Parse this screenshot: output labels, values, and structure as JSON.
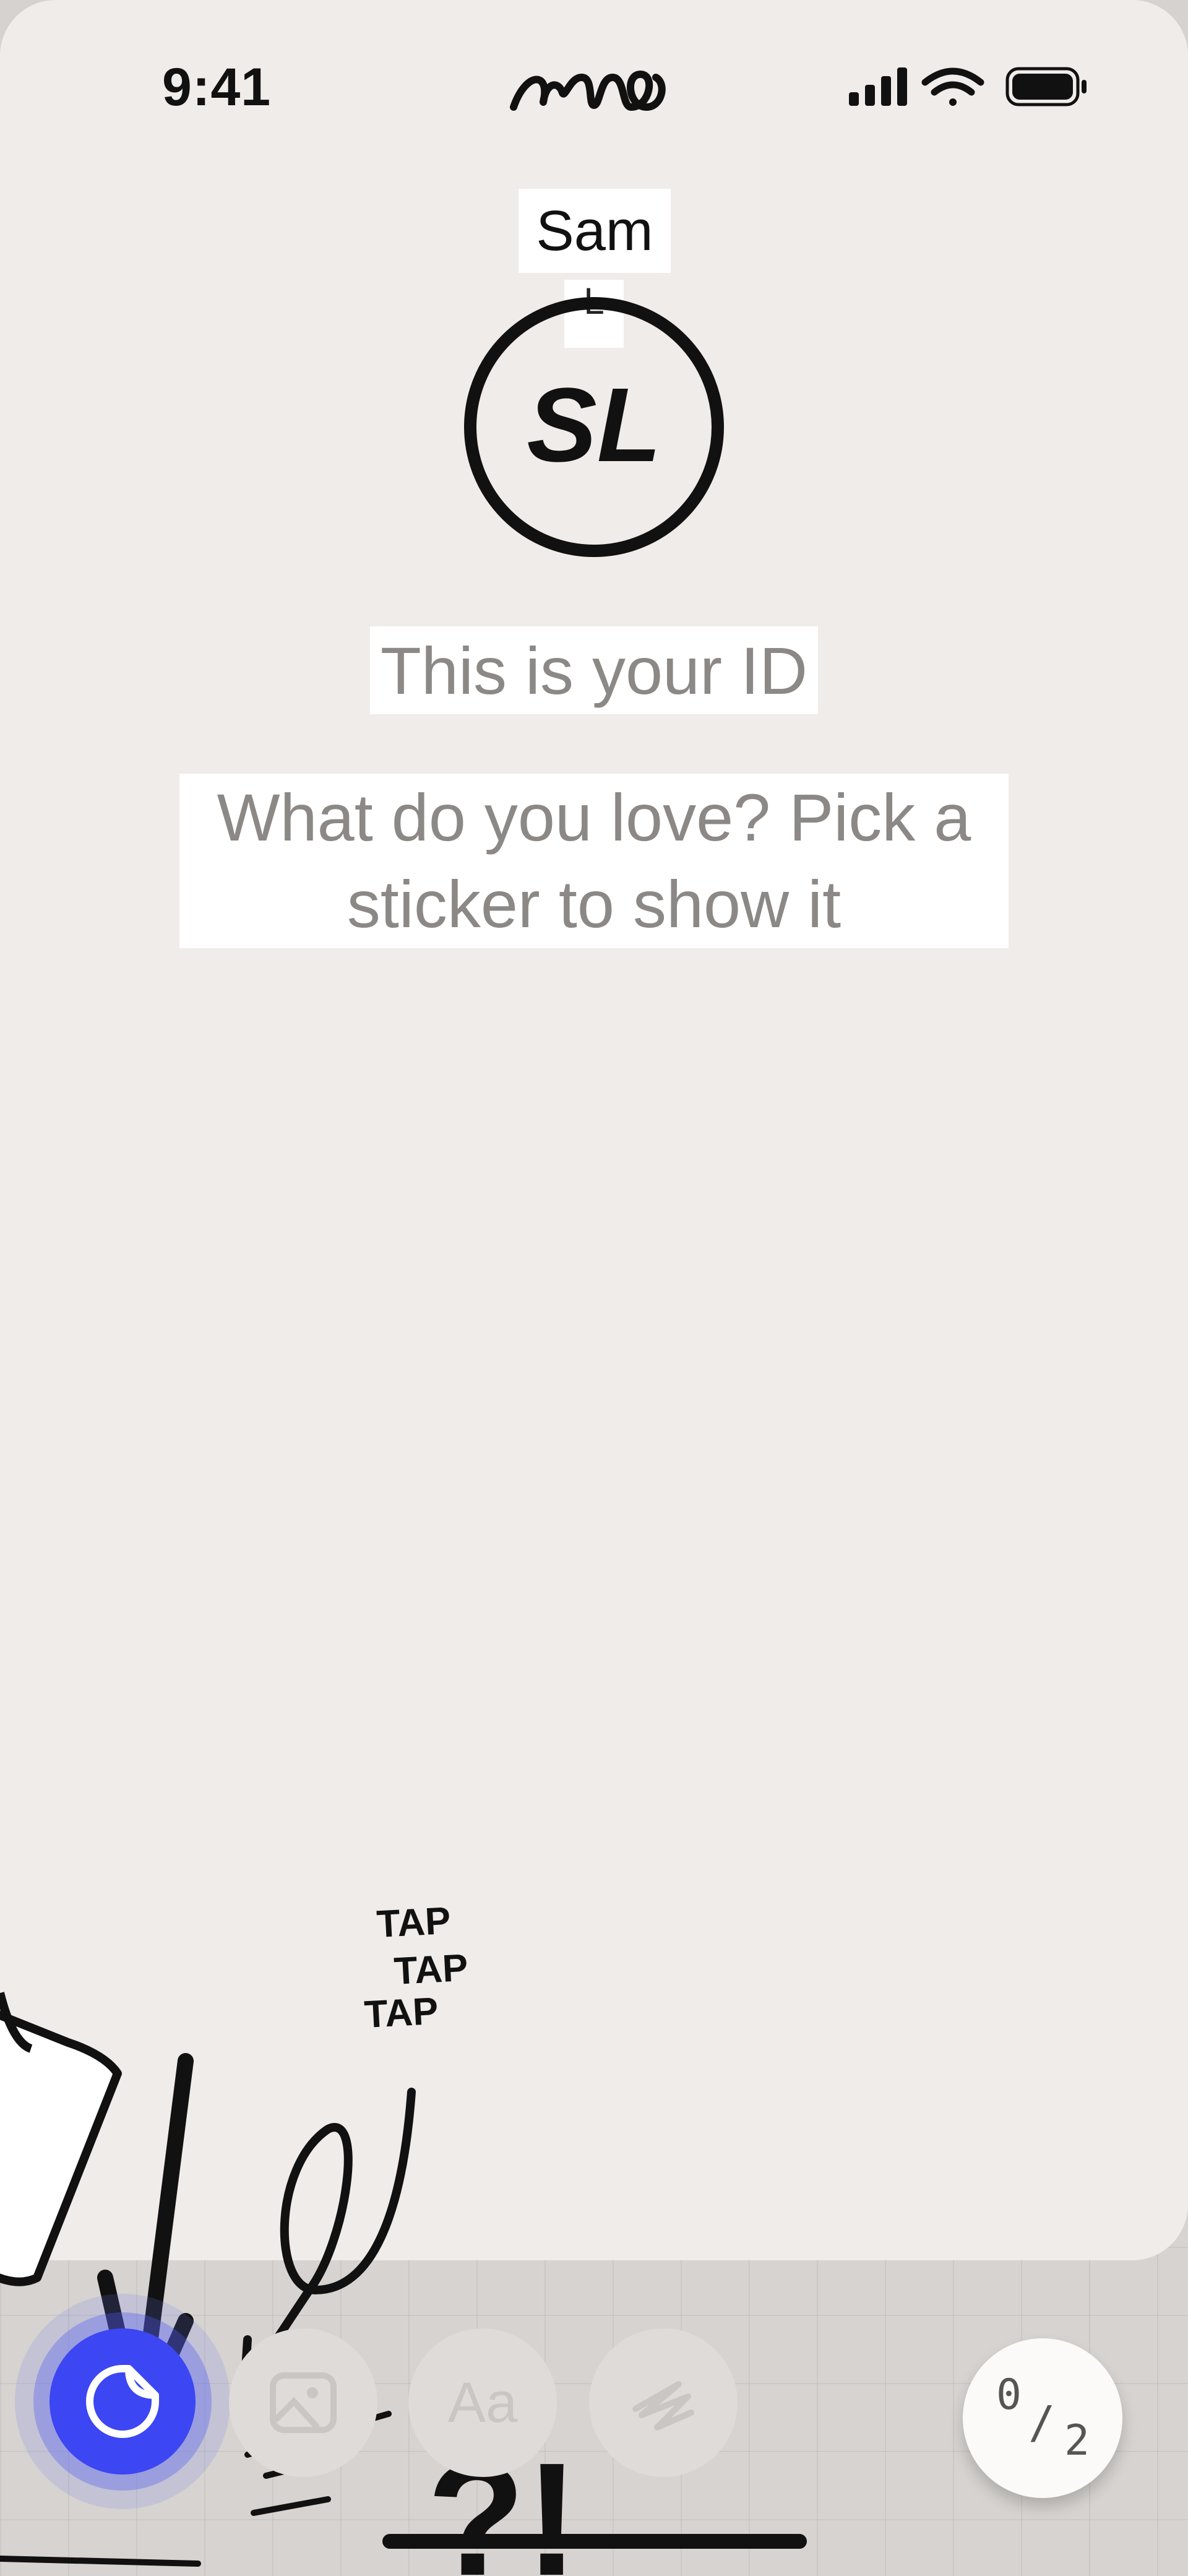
{
  "status_bar": {
    "time": "9:41",
    "brand": "amo",
    "icons": [
      "signal-icon",
      "wifi-icon",
      "battery-icon"
    ]
  },
  "profile": {
    "name": "Sam",
    "name_tag_mark": "L",
    "initials": "SL"
  },
  "content": {
    "heading": "This is your ID",
    "prompt_line1": "What do you love? Pick a",
    "prompt_line2": "sticker to show it"
  },
  "tutorial": {
    "taps": [
      "TAP",
      "TAP",
      "TAP"
    ],
    "question": "?!"
  },
  "toolbar": {
    "buttons": [
      {
        "name": "sticker",
        "icon": "sticker-icon",
        "active": true
      },
      {
        "name": "photo",
        "icon": "image-icon",
        "active": false
      },
      {
        "name": "text",
        "icon": "text-icon",
        "label": "Aa",
        "active": false
      },
      {
        "name": "draw",
        "icon": "scribble-icon",
        "active": false
      }
    ],
    "counter": {
      "current": "0",
      "total": "2"
    }
  },
  "colors": {
    "accent": "#3c46f2",
    "card": "#efecea",
    "muted_text": "#8b8885"
  }
}
